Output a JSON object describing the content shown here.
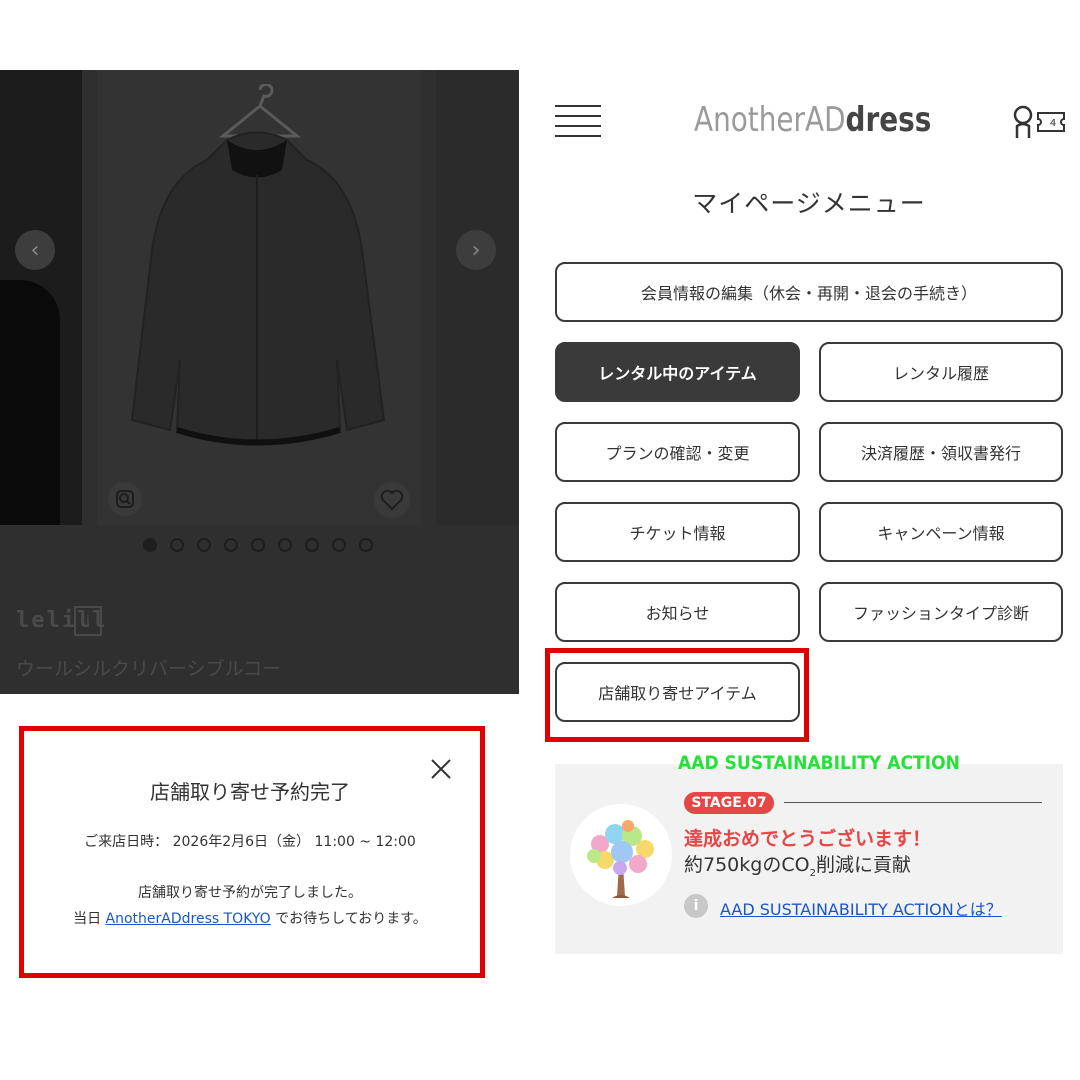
{
  "product": {
    "brand": "lelill",
    "name": "ウールシルクリバーシブルコー",
    "image_count": 9,
    "active_image": 1
  },
  "modal": {
    "title": "店舗取り寄せ予約完了",
    "datetime": "ご来店日時： 2026年2月6日（金） 11:00 ~ 12:00",
    "message1": "店舗取り寄せ予約が完了しました。",
    "message2_prefix": "当日 ",
    "message2_link": "AnotherADdress TOKYO",
    "message2_suffix": " でお待ちしております。"
  },
  "header": {
    "logo_light": "AnotherAD",
    "logo_dark": "dress",
    "ticket_count": "4"
  },
  "menu": {
    "title": "マイページメニュー",
    "member_edit": "会員情報の編集（休会・再開・退会の手続き）",
    "rental_current": "レンタル中のアイテム",
    "rental_history": "レンタル履歴",
    "plan": "プランの確認・変更",
    "payment": "決済履歴・領収書発行",
    "ticket": "チケット情報",
    "campaign": "キャンペーン情報",
    "news": "お知らせ",
    "fashion_type": "ファッションタイプ診断",
    "store_items": "店舗取り寄せアイテム"
  },
  "sustainability": {
    "heading": "AAD SUSTAINABILITY ACTION",
    "stage": "STAGE.07",
    "congrats": "達成おめでとうございます！",
    "reduction_prefix": "約750kgのCO",
    "reduction_sub": "2",
    "reduction_suffix": "削減に貢献",
    "link": "AAD SUSTAINABILITY ACTIONとは？"
  },
  "colors": {
    "highlight": "#e00000",
    "stage_red": "#e64646",
    "sus_green": "#28e03a",
    "link_blue": "#1a56c8"
  }
}
